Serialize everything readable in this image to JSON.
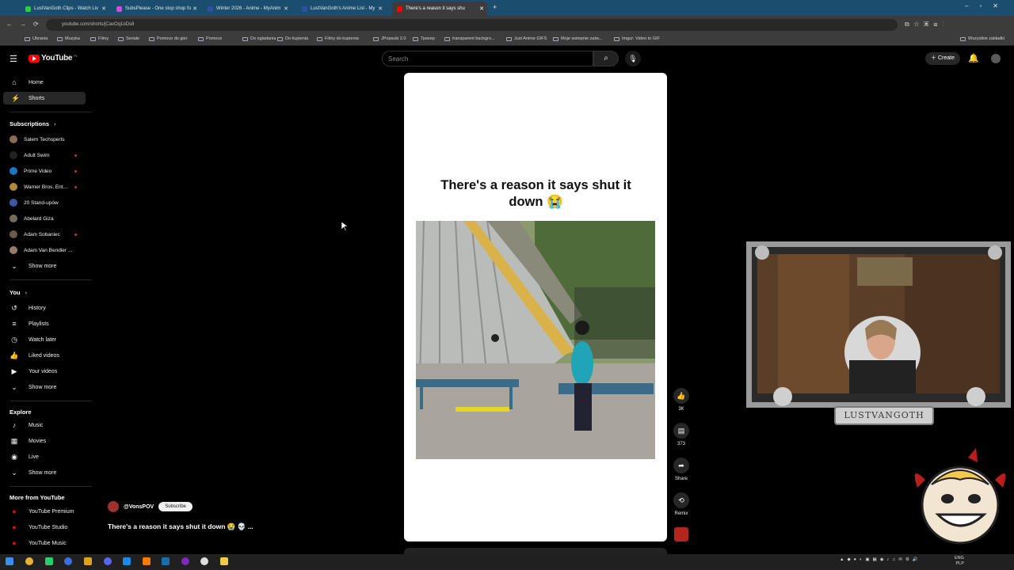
{
  "browser": {
    "tabs": [
      {
        "title": "LustVanGoth Clips - Watch Liv",
        "color": "#2ecc40"
      },
      {
        "title": "SubsPlease - One stop shop fo",
        "color": "#d94bd6"
      },
      {
        "title": "Winter 2026 - Anime - MyAnim",
        "color": "#2e51a2"
      },
      {
        "title": "LustVanGoth's Anime List - My",
        "color": "#2e51a2"
      },
      {
        "title": "There's a reason it says shu",
        "color": "#ff0000"
      }
    ],
    "url": "youtube.com/shorts/jCavOq1oDs8",
    "bookmarks": [
      "Ubrania",
      "Muzyka",
      "Filmy",
      "Seriale",
      "Pomoce do gier",
      "Pomoce",
      "Do ogladania",
      "Do kupienia",
      "Filmy do kupienia",
      "JPopsuki 2.0",
      "Трекер",
      "transparent backgro...",
      "Just Anime GIFS",
      "Moje wstepnie zatw...",
      "Imgur: Video to GIF"
    ],
    "bookmarks_right": "Wszystkie zakładki"
  },
  "header": {
    "logo": "YouTube",
    "logo_sup": "PL",
    "search_placeholder": "Search",
    "create_label": "Create"
  },
  "sidebar": {
    "nav": [
      {
        "label": "Home",
        "icon": "home-icon"
      },
      {
        "label": "Shorts",
        "icon": "shorts-icon"
      }
    ],
    "subscriptions_title": "Subscriptions",
    "subscriptions": [
      {
        "name": "Salem Techsperts",
        "color": "#8a6a5a",
        "live": false
      },
      {
        "name": "Adult Swim",
        "color": "#222222",
        "live": true
      },
      {
        "name": "Prime Video",
        "color": "#1a78c2",
        "live": true
      },
      {
        "name": "Warner Bros. Ent...",
        "color": "#b08a3a",
        "live": true
      },
      {
        "name": "20 Stand-upów",
        "color": "#3a5aa8",
        "live": false
      },
      {
        "name": "Abelard Giza",
        "color": "#7a6a5a",
        "live": false
      },
      {
        "name": "Adam Sobaniec",
        "color": "#6a5a4a",
        "live": true
      },
      {
        "name": "Adam Van Bendler ...",
        "color": "#9a7a6a",
        "live": false
      }
    ],
    "show_more": "Show more",
    "you_title": "You",
    "you_items": [
      {
        "label": "History",
        "icon": "history-icon"
      },
      {
        "label": "Playlists",
        "icon": "playlists-icon"
      },
      {
        "label": "Watch later",
        "icon": "watch-later-icon"
      },
      {
        "label": "Liked videos",
        "icon": "like-icon"
      },
      {
        "label": "Your videos",
        "icon": "your-videos-icon"
      }
    ],
    "explore_title": "Explore",
    "explore_items": [
      {
        "label": "Music",
        "icon": "music-icon"
      },
      {
        "label": "Movies",
        "icon": "movies-icon"
      },
      {
        "label": "Live",
        "icon": "live-icon"
      }
    ],
    "more_title": "More from YouTube",
    "more_items": [
      "YouTube Premium",
      "YouTube Studio",
      "YouTube Music"
    ]
  },
  "short": {
    "overlay_title": "There's a reason it says shut it down 😭",
    "channel": "@VonsPOV",
    "subscribe_label": "Subscribe",
    "video_title": "There's a reason it says shut it down 😭 💀 ...",
    "actions": [
      {
        "label": "3K",
        "icon": "thumbs-up-icon"
      },
      {
        "label": "373",
        "icon": "comments-icon"
      },
      {
        "label": "Share",
        "icon": "share-icon"
      },
      {
        "label": "Remix",
        "icon": "remix-icon"
      }
    ]
  },
  "stream_overlay": {
    "name_plate": "LUSTVANGOTH"
  },
  "taskbar": {
    "lang_top": "ENG",
    "lang_bottom": "PLP"
  }
}
